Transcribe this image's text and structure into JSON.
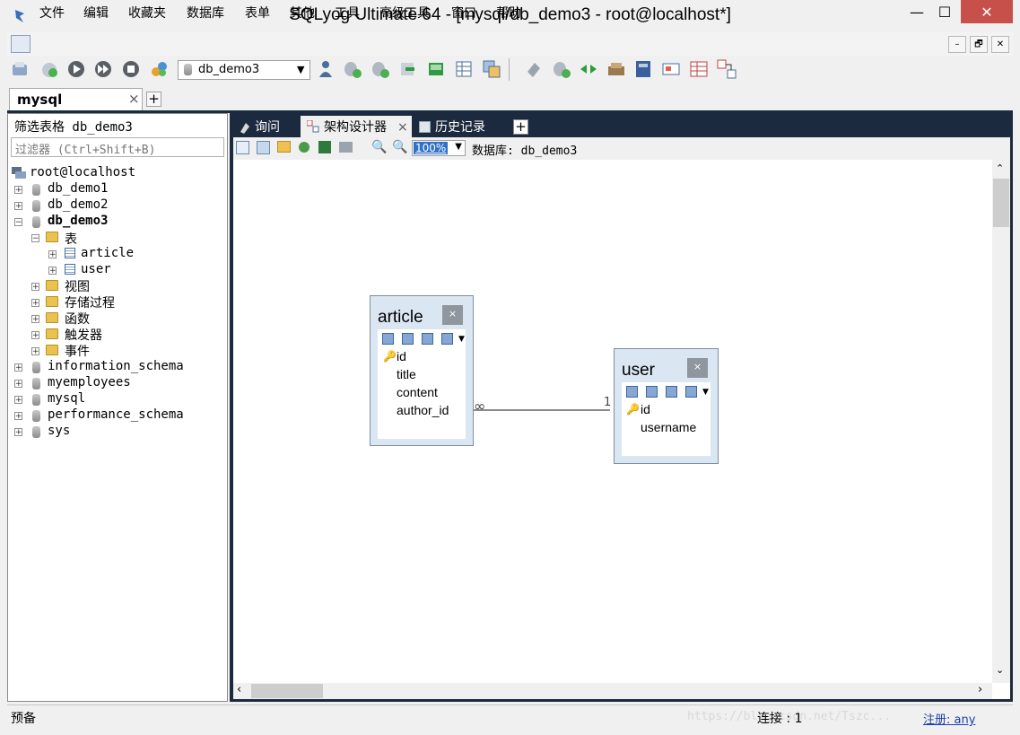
{
  "window": {
    "title": "SQLyog Ultimate 64 - [mysql/db_demo3 - root@localhost*]",
    "min_glyph": "—",
    "max_glyph": "☐",
    "close_glyph": "✕"
  },
  "menu": {
    "items": [
      "文件",
      "编辑",
      "收藏夹",
      "数据库",
      "表单",
      "其他",
      "工具",
      "高级工具",
      "窗口",
      "帮助"
    ],
    "mdi": [
      "–",
      "🗗",
      "✕"
    ]
  },
  "toolbar": {
    "db_select_value": "db_demo3",
    "icons_left": [
      "connect-icon",
      "new-connection-icon",
      "execute-query-icon",
      "execute-all-icon",
      "stop-icon",
      "refresh-icon"
    ],
    "icons_right": [
      "user-manager-icon",
      "backup-db-icon",
      "restore-db-icon",
      "import-icon",
      "export-icon",
      "copy-db-icon",
      "schema-sync-icon",
      "query-builder-icon",
      "sql-scheduler-icon",
      "data-sync-icon",
      "notifications-icon",
      "migration-icon",
      "table-diag-icon",
      "history-icon",
      "schema-designer-icon"
    ]
  },
  "connection_tab": {
    "label": "mysql",
    "close": "×",
    "add": "+"
  },
  "object_browser": {
    "filter_label": "筛选表格 db_demo3",
    "filter_placeholder": "过滤器 (Ctrl+Shift+B)",
    "root": "root@localhost",
    "databases": [
      "db_demo1",
      "db_demo2",
      "db_demo3",
      "information_schema",
      "myemployees",
      "mysql",
      "performance_schema",
      "sys"
    ],
    "expanded_db": "db_demo3",
    "folders": {
      "tables": "表",
      "views": "视图",
      "procedures": "存储过程",
      "functions": "函数",
      "triggers": "触发器",
      "events": "事件"
    },
    "tables": [
      "article",
      "user"
    ]
  },
  "tabs": {
    "query": "询问",
    "schema": "架构设计器",
    "history": "历史记录",
    "close": "×",
    "add": "+"
  },
  "designer": {
    "zoom": "100%",
    "db_label": "数据库: db_demo3",
    "entities": {
      "article": {
        "name": "article",
        "fields": [
          "id",
          "title",
          "content",
          "author_id"
        ],
        "pk": "id"
      },
      "user": {
        "name": "user",
        "fields": [
          "id",
          "username"
        ],
        "pk": "id"
      }
    },
    "relation": {
      "many": "∞",
      "one": "1"
    }
  },
  "status": {
    "left": "预备",
    "connections": "连接 : 1",
    "register_prefix": "注册:",
    "register_value": "any",
    "watermark": "https://blog.csdn.net/Tszc..."
  }
}
